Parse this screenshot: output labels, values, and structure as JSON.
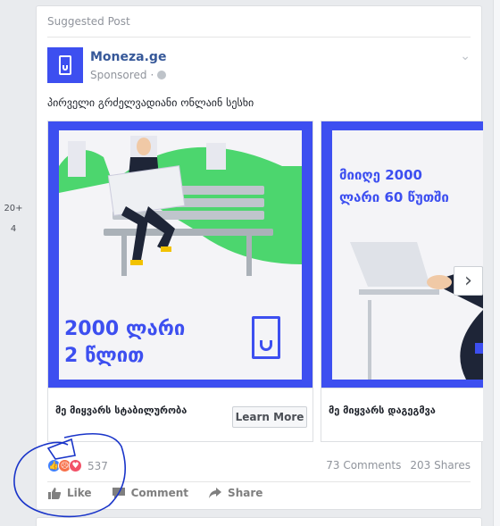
{
  "left_counts": [
    "20+",
    "4"
  ],
  "card": {
    "suggested_label": "Suggested Post",
    "page_name": "Moneza.ge",
    "sponsored_label": "Sponsored",
    "post_text": "პირველი გრძელვადიანი ონლაინ სესხი"
  },
  "carousel": {
    "slides": [
      {
        "ad_line1": "2000 ლარი",
        "ad_line2": "2 წლით",
        "title": "მე მიყვარს სტაბილურობა",
        "cta": "Learn More"
      },
      {
        "ad_line1": "მიიღე 2000",
        "ad_line2": "ლარი 60 წუთში",
        "title": "მე მიყვარს დაგეგმვა"
      }
    ]
  },
  "reactions": {
    "count": "537",
    "comments": "73 Comments",
    "shares": "203 Shares"
  },
  "actions": {
    "like": "Like",
    "comment": "Comment",
    "share": "Share"
  },
  "colors": {
    "brand_blue": "#3d4ff0",
    "link_blue": "#365899",
    "annotation": "#1a35c9"
  }
}
